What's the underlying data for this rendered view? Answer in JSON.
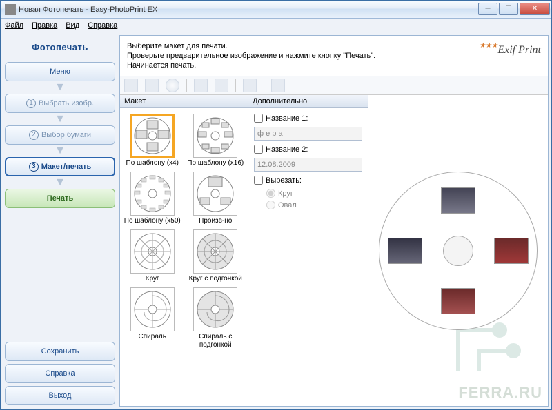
{
  "window": {
    "title": "Новая Фотопечать - Easy-PhotoPrint EX"
  },
  "menubar": {
    "file": "Файл",
    "edit": "Правка",
    "view": "Вид",
    "help": "Справка"
  },
  "sidebar": {
    "title": "Фотопечать",
    "menu": "Меню",
    "step1": "Выбрать изобр.",
    "step2": "Выбор бумаги",
    "step3": "Макет/печать",
    "print": "Печать",
    "save": "Сохранить",
    "help": "Справка",
    "exit": "Выход"
  },
  "instructions": {
    "line1": "Выберите макет для печати.",
    "line2": "Проверьте предварительное изображение и нажмите кнопку \"Печать\".",
    "line3": "Начинается печать."
  },
  "exif": "Exif Print",
  "panels": {
    "layout_head": "Макет",
    "additional_head": "Дополнительно"
  },
  "layouts": [
    {
      "label": "По шаблону (x4)"
    },
    {
      "label": "По шаблону (x16)"
    },
    {
      "label": "По шаблону (x50)"
    },
    {
      "label": "Произв-но"
    },
    {
      "label": "Круг"
    },
    {
      "label": "Круг с подгонкой"
    },
    {
      "label": "Спираль"
    },
    {
      "label": "Спираль с подгонкой"
    }
  ],
  "additional": {
    "title1_label": "Название 1:",
    "title1_value": "ф е р а",
    "title2_label": "Название 2:",
    "title2_value": "12.08.2009",
    "crop_label": "Вырезать:",
    "circle": "Круг",
    "oval": "Овал"
  },
  "watermark": "FERRA.RU"
}
